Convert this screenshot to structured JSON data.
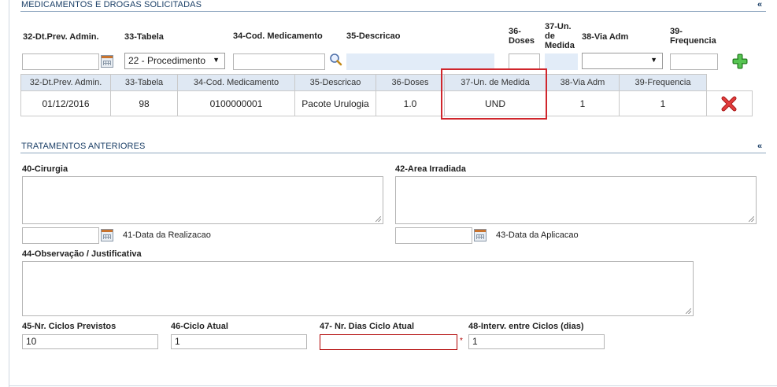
{
  "sections": {
    "medicamentos": {
      "title": "MEDICAMENTOS E DROGAS SOLICITADAS",
      "collapse": "«"
    },
    "tratamentos": {
      "title": "TRATAMENTOS ANTERIORES",
      "collapse": "«"
    }
  },
  "form": {
    "labels": {
      "dt_prev": "32-Dt.Prev. Admin.",
      "tabela": "33-Tabela",
      "cod_med": "34-Cod. Medicamento",
      "descricao": "35-Descricao",
      "doses_l1": "36-",
      "doses_l2": "Doses",
      "un_l1": "37-Un.",
      "un_l2": "de",
      "un_l3": "Medida",
      "via": "38-Via Adm",
      "freq_l1": "39-",
      "freq_l2": "Frequencia"
    },
    "tabela_selected": "22 - Procedimento",
    "via_selected": ""
  },
  "grid": {
    "headers": [
      "32-Dt.Prev. Admin.",
      "33-Tabela",
      "34-Cod. Medicamento",
      "35-Descricao",
      "36-Doses",
      "37-Un. de Medida",
      "38-Via Adm",
      "39-Frequencia"
    ],
    "rows": [
      {
        "dt": "01/12/2016",
        "tabela": "98",
        "cod": "0100000001",
        "desc": "Pacote Urulogia",
        "doses": "1.0",
        "un": "UND",
        "via": "1",
        "freq": "1"
      }
    ]
  },
  "tratamentos": {
    "cirurgia_label": "40-Cirurgia",
    "area_label": "42-Area Irradiada",
    "data_realizacao_label": "41-Data da Realizacao",
    "data_aplicacao_label": "43-Data da Aplicacao",
    "obs_label": "44-Observação / Justificativa",
    "ciclos_previstos_label": "45-Nr. Ciclos Previstos",
    "ciclos_previstos_value": "10",
    "ciclo_atual_label": "46-Ciclo Atual",
    "ciclo_atual_value": "1",
    "dias_ciclo_label": "47- Nr. Dias Ciclo Atual",
    "dias_ciclo_value": "",
    "required_mark": "*",
    "interv_label": "48-Interv. entre Ciclos (dias)",
    "interv_value": "1"
  },
  "colors": {
    "section_title": "#1a3e66",
    "grid_header_bg": "#dfe8f3",
    "highlight": "#d0262c",
    "add_icon": "#3aa635",
    "delete_icon": "#d62a2a"
  }
}
